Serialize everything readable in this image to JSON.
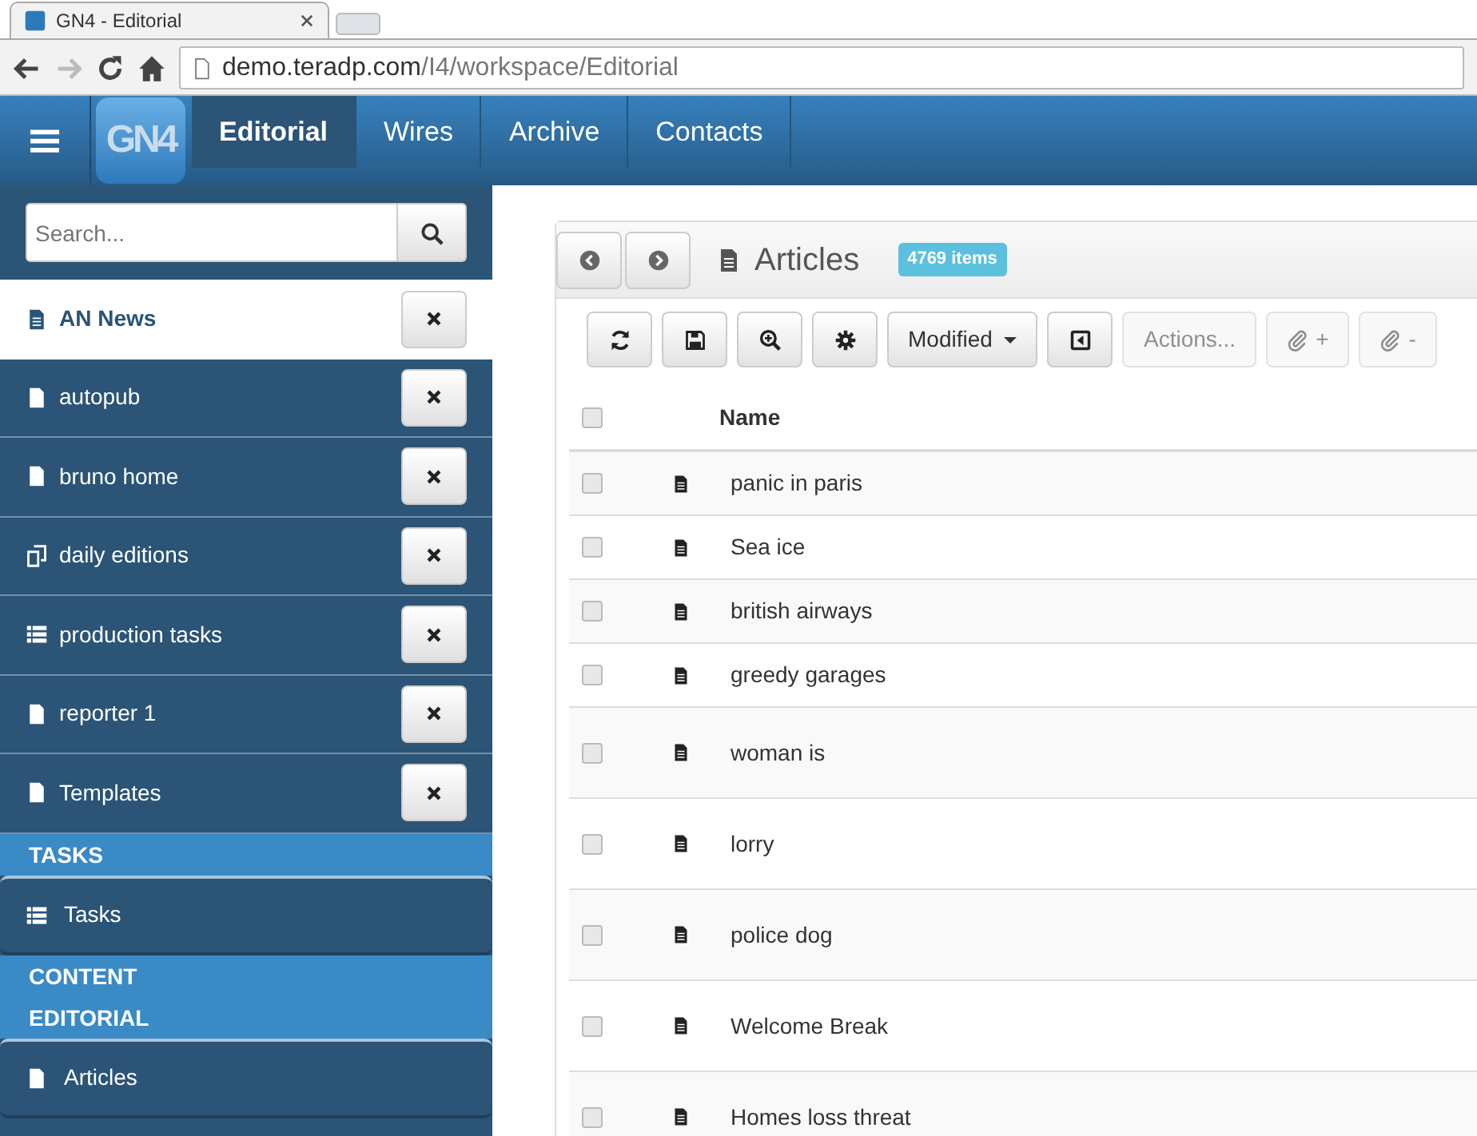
{
  "browser": {
    "tab_title": "GN4 - Editorial",
    "address_host": "demo.teradp.com",
    "address_path": "/I4/workspace/Editorial"
  },
  "navbar": {
    "logo": "GN4",
    "tabs": [
      {
        "label": "Editorial",
        "selected": true
      },
      {
        "label": "Wires",
        "selected": false
      },
      {
        "label": "Archive",
        "selected": false
      },
      {
        "label": "Contacts",
        "selected": false
      }
    ]
  },
  "sidebar": {
    "search": {
      "placeholder": "Search..."
    },
    "workspaces": [
      {
        "label": "AN News",
        "kind": "document",
        "selected": true
      },
      {
        "label": "autopub",
        "kind": "document",
        "selected": false
      },
      {
        "label": "bruno home",
        "kind": "document",
        "selected": false
      },
      {
        "label": "daily editions",
        "kind": "edition",
        "selected": false
      },
      {
        "label": "production tasks",
        "kind": "list",
        "selected": false
      },
      {
        "label": "reporter 1",
        "kind": "document",
        "selected": false
      },
      {
        "label": "Templates",
        "kind": "document",
        "selected": false
      }
    ],
    "sections": [
      {
        "headings": [
          "TASKS"
        ],
        "items": [
          {
            "label": "Tasks",
            "kind": "list"
          }
        ]
      },
      {
        "headings": [
          "CONTENT",
          "EDITORIAL"
        ],
        "items": [
          {
            "label": "Articles",
            "kind": "document"
          }
        ]
      }
    ]
  },
  "panel": {
    "title": "Articles",
    "count": "4769 items",
    "toolbar": [
      {
        "kind": "refresh",
        "disabled": false
      },
      {
        "kind": "save",
        "disabled": false
      },
      {
        "kind": "zoom",
        "disabled": false
      },
      {
        "kind": "settings",
        "disabled": false
      },
      {
        "kind": "dropdown",
        "label": "Modified",
        "disabled": false
      },
      {
        "kind": "collapse",
        "disabled": false
      },
      {
        "kind": "text",
        "label": "Actions...",
        "disabled": true
      },
      {
        "kind": "attach",
        "label": "+",
        "disabled": true
      },
      {
        "kind": "attach",
        "label": "-",
        "disabled": true
      }
    ],
    "table": {
      "columns": [
        "Name"
      ],
      "all_checked": false,
      "rows": [
        {
          "name": "panic in paris",
          "checked": false
        },
        {
          "name": "Sea ice",
          "checked": false
        },
        {
          "name": "british airways",
          "checked": false
        },
        {
          "name": "greedy garages",
          "checked": false
        },
        {
          "name": "woman is",
          "checked": false
        },
        {
          "name": "lorry",
          "checked": false
        },
        {
          "name": "police dog",
          "checked": false
        },
        {
          "name": "Welcome Break",
          "checked": false
        },
        {
          "name": "Homes loss threat",
          "checked": false
        }
      ]
    }
  }
}
